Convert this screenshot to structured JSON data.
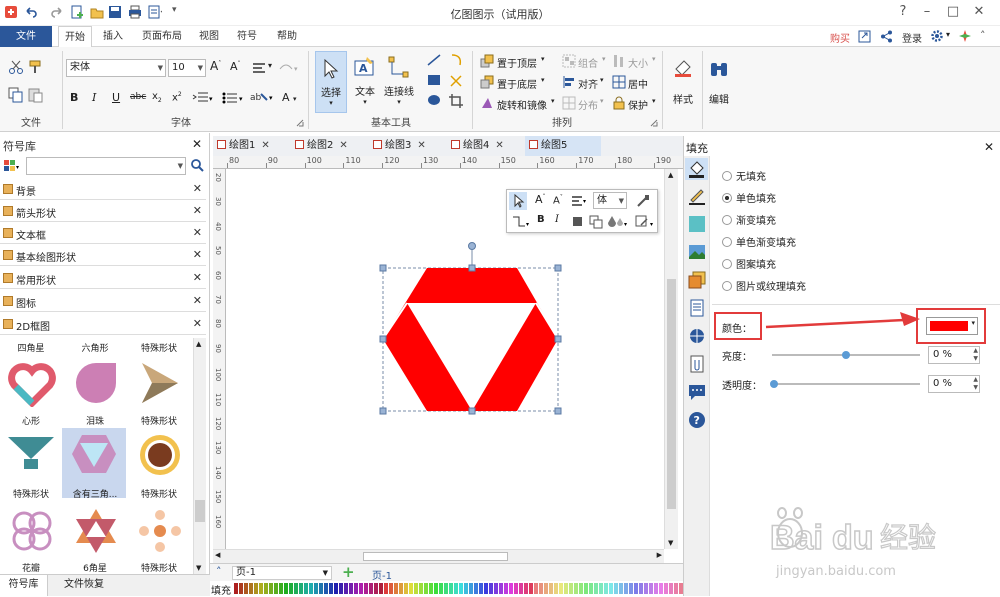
{
  "app": {
    "title": "亿图图示（试用版）"
  },
  "menu": {
    "file": "文件",
    "tabs": [
      "开始",
      "插入",
      "页面布局",
      "视图",
      "符号",
      "帮助"
    ],
    "buy": "购买",
    "login": "登录"
  },
  "ribbon": {
    "font_name": "宋体",
    "font_size": "10",
    "groups": {
      "file": "文件",
      "font": "字体",
      "basic_tools": "基本工具",
      "arrange": "排列"
    },
    "tools": {
      "select": "选择",
      "text": "文本",
      "connector": "连接线",
      "style": "样式",
      "edit": "编辑"
    },
    "arrange": {
      "bring_front": "置于顶层",
      "send_back": "置于底层",
      "rotate_mirror": "旋转和镜像",
      "group": "组合",
      "align": "对齐",
      "distribute": "分布",
      "size": "大小",
      "center": "居中",
      "protect": "保护"
    }
  },
  "library": {
    "title": "符号库",
    "categories": [
      "背景",
      "箭头形状",
      "文本框",
      "基本绘图形状",
      "常用形状",
      "图标",
      "2D框图"
    ],
    "shapes_top": [
      "四角星",
      "六角形",
      "特殊形状"
    ],
    "shapes": [
      [
        "心形",
        "泪珠",
        "特殊形状"
      ],
      [
        "特殊形状",
        "含有三角...",
        "特殊形状"
      ],
      [
        "花瓣",
        "6角星",
        "特殊形状"
      ]
    ],
    "bottom_tabs": [
      "符号库",
      "文件恢复"
    ]
  },
  "doc_tabs": [
    "绘图1",
    "绘图2",
    "绘图3",
    "绘图4",
    "绘图5"
  ],
  "active_doc": "绘图5",
  "ruler": {
    "h": [
      "80",
      "90",
      "100",
      "110",
      "120",
      "130",
      "140",
      "150",
      "160",
      "170",
      "180",
      "190"
    ],
    "v": [
      "20",
      "30",
      "40",
      "50",
      "60",
      "70",
      "80",
      "90",
      "100",
      "110",
      "120",
      "130",
      "140",
      "150",
      "160"
    ]
  },
  "floating": {
    "font": "体"
  },
  "page": {
    "selector": "页-1",
    "tab": "页-1"
  },
  "colorbar": {
    "label": "填充"
  },
  "fill": {
    "title": "填充",
    "options": [
      "无填充",
      "单色填充",
      "渐变填充",
      "单色渐变填充",
      "图案填充",
      "图片或纹理填充"
    ],
    "selected": "单色填充",
    "color_label": "颜色：",
    "color_value": "#ff0000",
    "brightness_label": "亮度：",
    "brightness_value": "0 %",
    "transparency_label": "透明度：",
    "transparency_value": "0 %",
    "brightness": 0.5,
    "transparency": 0.0
  },
  "colors": {
    "accent": "#2b579a",
    "shape": "#ff0000",
    "annotation": "#e23b3b"
  }
}
